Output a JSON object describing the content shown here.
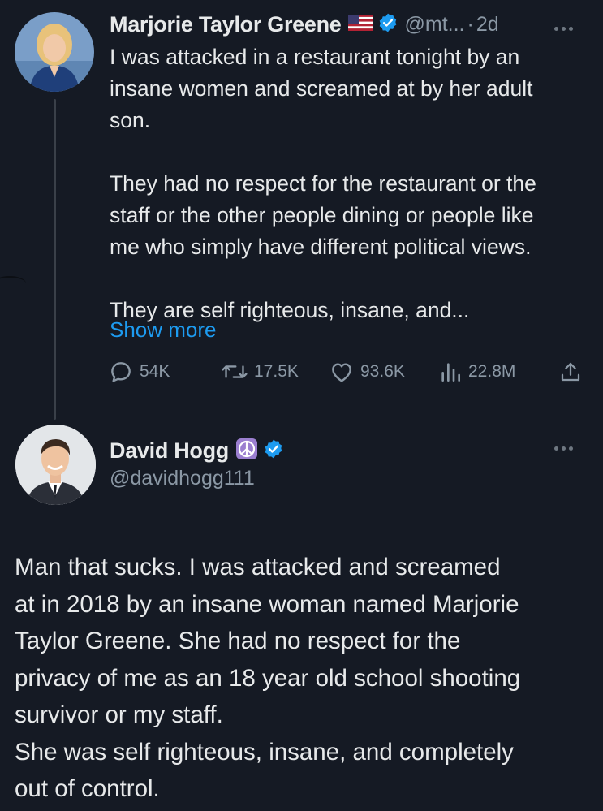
{
  "tweet1": {
    "display_name": "Marjorie Taylor Greene",
    "handle": "@mt...",
    "separator": "·",
    "time": "2d",
    "text": "I was attacked in a restaurant tonight by an\ninsane women and screamed at by her adult\nson.\n\nThey had no respect for the restaurant or the\nstaff or the other people dining or people like\nme who simply have different political views.\n\nThey are self righteous, insane, and...",
    "show_more": "Show more",
    "stats": {
      "replies": "54K",
      "reposts": "17.5K",
      "likes": "93.6K",
      "views": "22.8M"
    },
    "icons": [
      "us-flag-icon",
      "verified-badge-icon",
      "more-icon",
      "reply-icon",
      "repost-icon",
      "like-icon",
      "views-icon",
      "share-icon"
    ]
  },
  "tweet2": {
    "display_name": "David Hogg",
    "handle": "@davidhogg111",
    "text": "Man that sucks. I was attacked and screamed\nat in 2018 by an insane woman named Marjorie\nTaylor Greene. She had no respect for the\nprivacy of me as an 18 year old school shooting\nsurvivor or my staff.\nShe was self righteous, insane, and completely\nout of control.",
    "icons": [
      "peace-sign-icon",
      "verified-badge-icon",
      "more-icon"
    ]
  },
  "colors": {
    "background": "#151a24",
    "text": "#e7e9ea",
    "secondary_text": "#8b98a5",
    "link": "#1d9bf0",
    "verified": "#1d9bf0",
    "peace_badge": "#9b7fd0"
  }
}
